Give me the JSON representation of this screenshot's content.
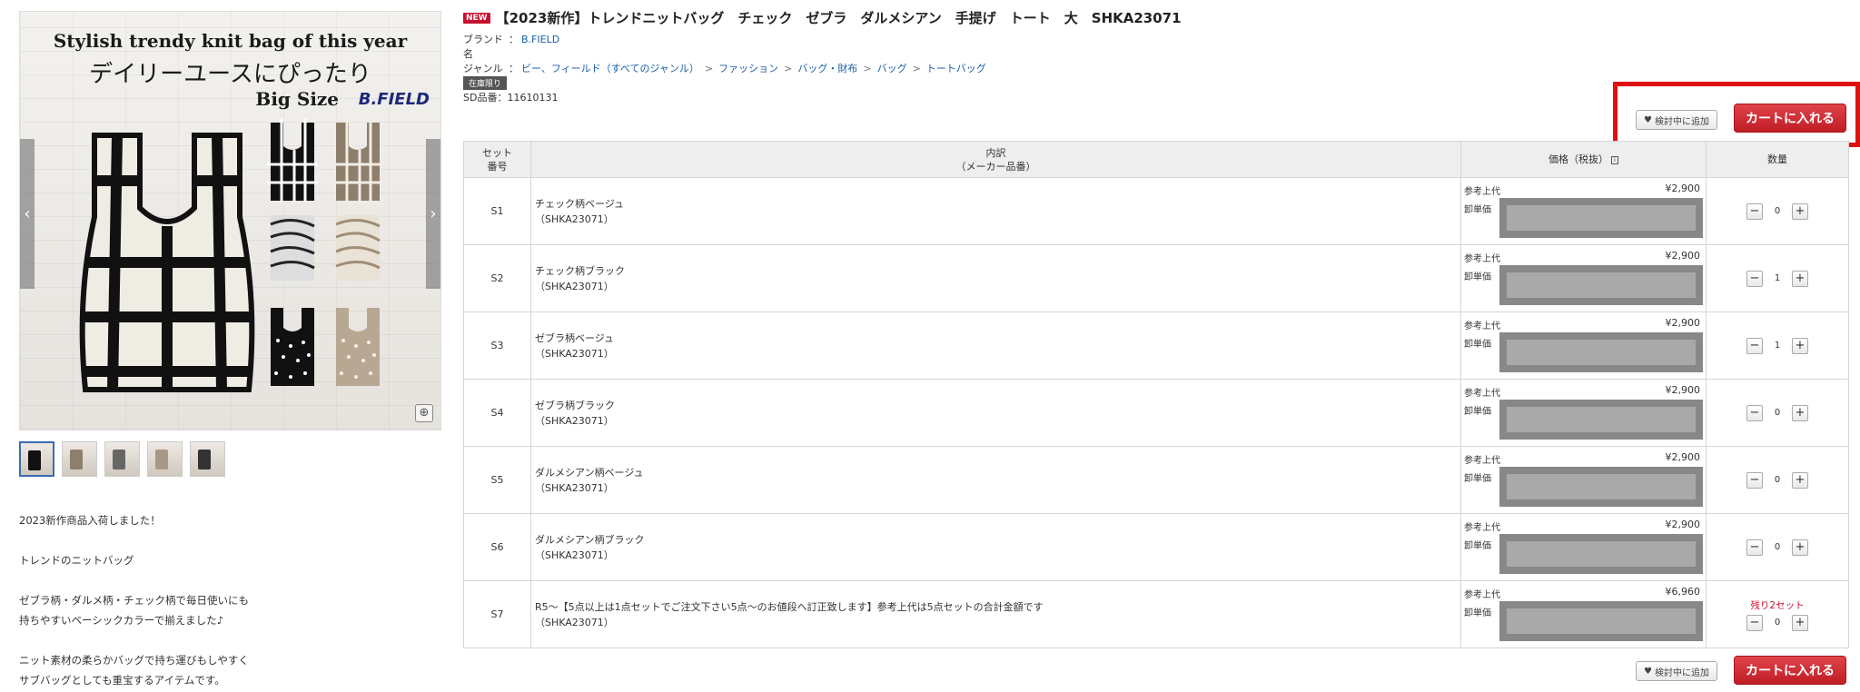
{
  "gallery": {
    "banner_line1": "Stylish trendy knit bag of this year",
    "banner_line2": "デイリーユースにぴったり",
    "banner_line3": "Big Size",
    "banner_logo": "B.FIELD",
    "prev_icon": "chevron-left-icon",
    "next_icon": "chevron-right-icon",
    "zoom_icon": "zoom-in-icon",
    "thumbnail_count": 5
  },
  "description": [
    "2023新作商品入荷しました！",
    "",
    "トレンドのニットバッグ",
    "",
    "ゼブラ柄・ダルメ柄・チェック柄で毎日使いにも",
    "持ちやすいベーシックカラーで揃えました♪",
    "",
    "ニット素材の柔らかバッグで持ち運びもしやすく",
    "サブバッグとしても重宝するアイテムです。"
  ],
  "product": {
    "new_badge": "NEW",
    "title": "【2023新作】トレンドニットバッグ　チェック　ゼブラ　ダルメシアン　手提げ　トート　大　SHKA23071",
    "brand_label": "ブランド名",
    "brand_value": "B.FIELD",
    "genre_label": "ジャンル",
    "genre_crumbs": [
      "ビー、フィールド（すべてのジャンル）",
      "ファッション",
      "バッグ・財布",
      "バッグ",
      "トートバッグ"
    ],
    "stock_badge": "在庫限り",
    "sd_number": "SD品番：11610131"
  },
  "actions": {
    "favorite_label": "検討中に追加",
    "cart_label": "カートに入れる"
  },
  "table": {
    "headers": {
      "set_no_line1": "セット",
      "set_no_line2": "番号",
      "naiyaku_line1": "内訳",
      "naiyaku_line2": "（メーカー品番）",
      "price": "価格（税抜）",
      "qty": "数量"
    },
    "price_ref_label": "参考上代",
    "price_wholesale_label": "卸単価",
    "rows": [
      {
        "set_no": "S1",
        "name": "チェック柄ベージュ",
        "code": "（SHKA23071）",
        "ref_price": "¥2,900",
        "qty": "0",
        "remaining": ""
      },
      {
        "set_no": "S2",
        "name": "チェック柄ブラック",
        "code": "（SHKA23071）",
        "ref_price": "¥2,900",
        "qty": "1",
        "remaining": ""
      },
      {
        "set_no": "S3",
        "name": "ゼブラ柄ベージュ",
        "code": "（SHKA23071）",
        "ref_price": "¥2,900",
        "qty": "1",
        "remaining": ""
      },
      {
        "set_no": "S4",
        "name": "ゼブラ柄ブラック",
        "code": "（SHKA23071）",
        "ref_price": "¥2,900",
        "qty": "0",
        "remaining": ""
      },
      {
        "set_no": "S5",
        "name": "ダルメシアン柄ベージュ",
        "code": "（SHKA23071）",
        "ref_price": "¥2,900",
        "qty": "0",
        "remaining": ""
      },
      {
        "set_no": "S6",
        "name": "ダルメシアン柄ブラック",
        "code": "（SHKA23071）",
        "ref_price": "¥2,900",
        "qty": "0",
        "remaining": ""
      },
      {
        "set_no": "S7",
        "name": "R5～【5点以上は1点セットでご注文下さい5点～のお値段へ訂正致します】参考上代は5点セットの合計金額です",
        "code": "（SHKA23071）",
        "ref_price": "¥6,960",
        "qty": "0",
        "remaining": "残り2セット"
      }
    ]
  },
  "colors": {
    "accent_red": "#c8102e",
    "cart_button": "#d02a33",
    "link_blue": "#1a5ea8",
    "highlight_box": "#e01010"
  }
}
